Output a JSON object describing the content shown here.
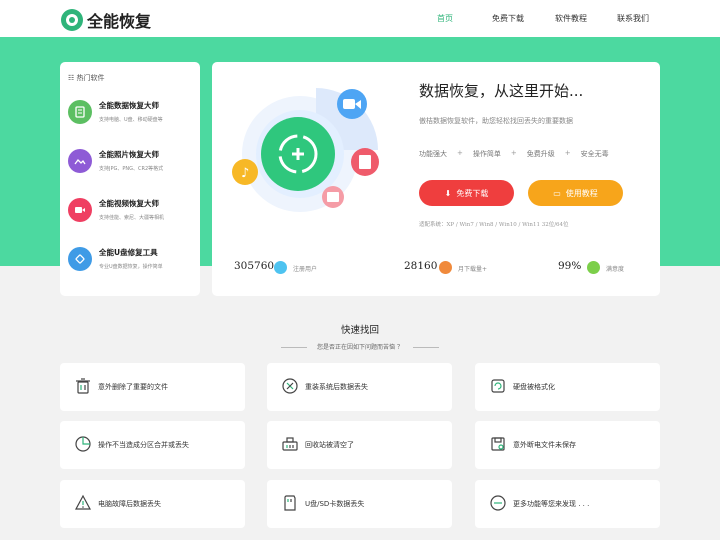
{
  "header": {
    "logo_text": "全能恢复",
    "nav": [
      "首页",
      "免费下载",
      "软件教程",
      "联系我们"
    ]
  },
  "sidebar": {
    "title": "热门软件",
    "items": [
      {
        "name": "全能数据恢复大师",
        "desc": "支持电脑、U盘、移动硬盘等",
        "color": "#5cbf62"
      },
      {
        "name": "全能照片恢复大师",
        "desc": "支持JPG、PNG、CR2等格式",
        "color": "#8e5bd6"
      },
      {
        "name": "全能视频恢复大师",
        "desc": "支持佳能、索尼、大疆等相机",
        "color": "#ef3f62"
      },
      {
        "name": "全能U盘修复工具",
        "desc": "专业U盘数据恢复，操作简单",
        "color": "#3f9be6"
      }
    ]
  },
  "hero": {
    "title": "数据恢复，从这里开始...",
    "subtitle": "傲桔数据恢复软件，助您轻松找回丢失的重要数据",
    "features": [
      "功能强大",
      "操作简单",
      "免费升级",
      "安全无毒"
    ],
    "feature_sep": "+",
    "download_btn": "免费下载",
    "tutorial_btn": "使用教程",
    "systems": "适配系统：XP / Win7 / Win8 / Win10 / Win11   32位/64位",
    "stats": [
      {
        "value": "305760",
        "label": "注册用户"
      },
      {
        "value": "28160",
        "label": "月下载量+"
      },
      {
        "value": "99%",
        "label": "满意度"
      }
    ]
  },
  "quick": {
    "title": "快速找回",
    "subtitle": "您是否正在因如下问题而苦恼 ？",
    "tiles": [
      {
        "label": "意外删除了重要的文件",
        "icon": "trash-icon"
      },
      {
        "label": "重装系统后数据丢失",
        "icon": "reinstall-icon"
      },
      {
        "label": "硬盘被格式化",
        "icon": "format-icon"
      },
      {
        "label": "操作不当造成分区合并或丢失",
        "icon": "partition-icon"
      },
      {
        "label": "回收站被清空了",
        "icon": "recycle-bin-icon"
      },
      {
        "label": "意外断电文件未保存",
        "icon": "save-icon"
      },
      {
        "label": "电脑故障后数据丢失",
        "icon": "warning-icon"
      },
      {
        "label": "U盘/SD卡数据丢失",
        "icon": "sd-card-icon"
      },
      {
        "label": "更多功能等您来发现 . . .",
        "icon": "more-icon"
      }
    ]
  },
  "colors": {
    "brand": "#4cd9a0",
    "accent": "#2fb47a",
    "red": "#ef3e3e",
    "orange": "#f7a51b"
  }
}
